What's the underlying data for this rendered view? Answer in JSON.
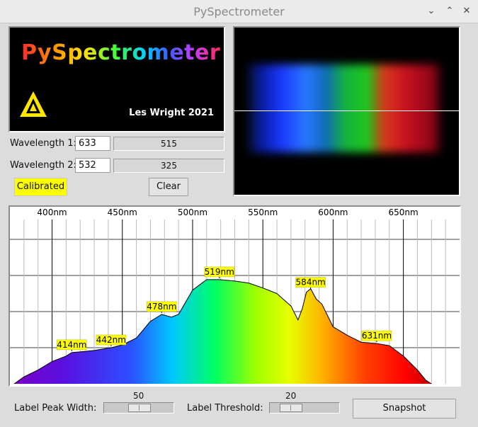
{
  "window": {
    "title": "PySpectrometer",
    "minimize_icon": "chevron-down-icon",
    "maximize_icon": "chevron-up-icon",
    "close_icon": "close-icon"
  },
  "logo": {
    "text": "PySpectrometer",
    "credit": "Les Wright 2021"
  },
  "calibration": {
    "wavelength1_label": "Wavelength 1:",
    "wavelength1_value": "633",
    "wavelength1_readout": "515",
    "wavelength2_label": "Wavelength 2:",
    "wavelength2_value": "532",
    "wavelength2_readout": "325",
    "calibrated_label": "Calibrated",
    "clear_label": "Clear"
  },
  "controls": {
    "peak_width_label": "Label Peak Width:",
    "peak_width_value": "50",
    "threshold_label": "Label Threshold:",
    "threshold_value": "20",
    "snapshot_label": "Snapshot"
  },
  "chart_data": {
    "type": "area",
    "xlabel": "",
    "ylabel": "",
    "grid": true,
    "x_ticks": [
      "400nm",
      "450nm",
      "500nm",
      "550nm",
      "600nm",
      "650nm"
    ],
    "xlim": [
      370,
      690
    ],
    "ylim": [
      0,
      255
    ],
    "peak_labels": [
      "414nm",
      "442nm",
      "478nm",
      "519nm",
      "584nm",
      "631nm"
    ],
    "peaks": [
      {
        "nm": 414,
        "value": 45
      },
      {
        "nm": 442,
        "value": 52
      },
      {
        "nm": 478,
        "value": 100
      },
      {
        "nm": 519,
        "value": 150
      },
      {
        "nm": 584,
        "value": 135
      },
      {
        "nm": 631,
        "value": 58
      }
    ],
    "x": [
      373,
      380,
      390,
      400,
      410,
      414,
      420,
      430,
      442,
      450,
      460,
      470,
      478,
      485,
      490,
      500,
      510,
      519,
      530,
      540,
      550,
      560,
      570,
      575,
      578,
      581,
      584,
      588,
      592,
      600,
      610,
      620,
      631,
      640,
      650,
      660,
      666,
      670
    ],
    "values": [
      0,
      10,
      20,
      32,
      40,
      45,
      46,
      48,
      52,
      56,
      66,
      90,
      100,
      96,
      100,
      135,
      150,
      150,
      148,
      145,
      138,
      130,
      112,
      92,
      108,
      132,
      137,
      122,
      115,
      82,
      70,
      60,
      58,
      55,
      40,
      20,
      5,
      0
    ]
  }
}
